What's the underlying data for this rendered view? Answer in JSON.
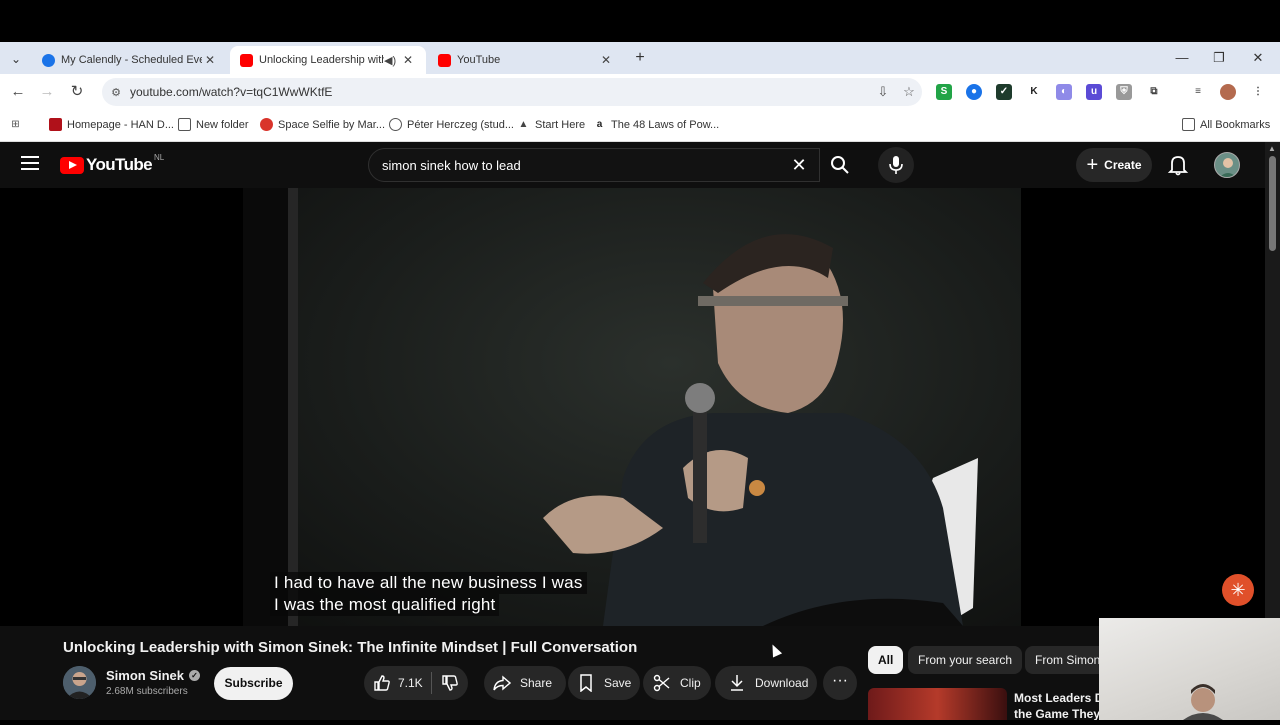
{
  "browser": {
    "tabs": [
      {
        "title": "My Calendly - Scheduled Events",
        "icon": "calendly-icon"
      },
      {
        "title": "Unlocking Leadership with Simon Sinek",
        "icon": "youtube-icon",
        "active": true,
        "audio": true
      },
      {
        "title": "YouTube",
        "icon": "youtube-icon"
      }
    ],
    "url": "youtube.com/watch?v=tqC1WwWKtfE",
    "bookmarks": [
      {
        "label": "Homepage - HAN D..."
      },
      {
        "label": "New folder"
      },
      {
        "label": "Space Selfie by Mar..."
      },
      {
        "label": "Péter Herczeg (stud..."
      },
      {
        "label": "Start Here"
      },
      {
        "label": "The 48 Laws of Pow..."
      }
    ],
    "all_bookmarks": "All Bookmarks"
  },
  "youtube": {
    "logo_text": "YouTube",
    "country_code": "NL",
    "search_query": "simon sinek how to lead",
    "create_label": "Create",
    "subtitle_line1": "I had to have all the new business I was",
    "subtitle_line2": "I was the most qualified right",
    "video_title": "Unlocking Leadership with Simon Sinek: The Infinite Mindset | Full Conversation",
    "channel_name": "Simon Sinek",
    "subscribers": "2.68M subscribers",
    "subscribe_label": "Subscribe",
    "likes": "7.1K",
    "share_label": "Share",
    "save_label": "Save",
    "clip_label": "Clip",
    "download_label": "Download",
    "chips": [
      "All",
      "From your search",
      "From Simon"
    ],
    "recommended": {
      "title_line1": "Most Leaders Do",
      "title_line2": "the Game They'r"
    }
  },
  "colors": {
    "accent": "#ff0000",
    "background": "#0f0f0f",
    "chrome": "#dfe6f2"
  }
}
